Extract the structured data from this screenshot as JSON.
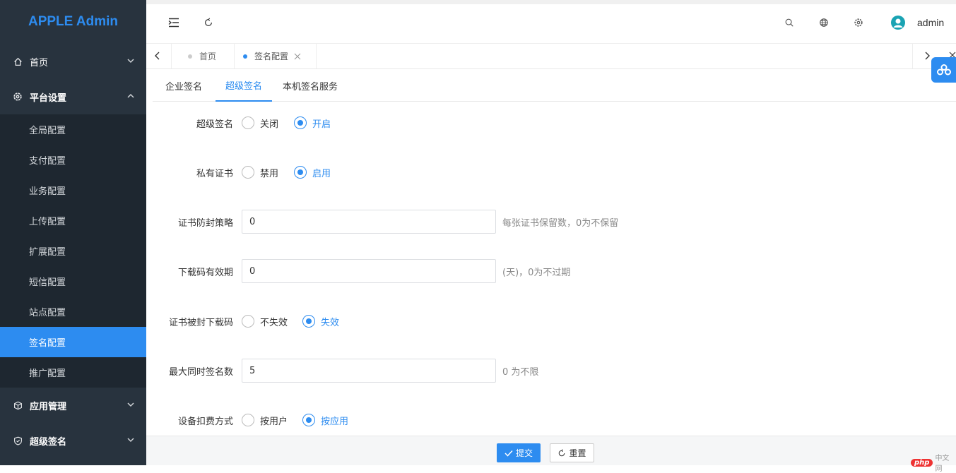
{
  "app": {
    "title": "APPLE Admin"
  },
  "sidebar": {
    "home": "首页",
    "platform": "平台设置",
    "sub_items": [
      "全局配置",
      "支付配置",
      "业务配置",
      "上传配置",
      "扩展配置",
      "短信配置",
      "站点配置",
      "签名配置",
      "推广配置"
    ],
    "active_sub": "签名配置",
    "app_mgmt": "应用管理",
    "super_sign": "超级签名"
  },
  "topbar": {
    "user": "admin"
  },
  "tabs": {
    "home": "首页",
    "current": "签名配置"
  },
  "subtabs": [
    "企业签名",
    "超级签名",
    "本机签名服务"
  ],
  "form": {
    "super_sign": {
      "label": "超级签名",
      "opt_off": "关闭",
      "opt_on": "开启",
      "selected": "开启"
    },
    "private_cert": {
      "label": "私有证书",
      "opt_off": "禁用",
      "opt_on": "启用",
      "selected": "启用"
    },
    "cert_policy": {
      "label": "证书防封策略",
      "value": "0",
      "hint": "每张证书保留数，0为不保留"
    },
    "download_valid": {
      "label": "下载码有效期",
      "value": "0",
      "hint": "(天)，0为不过期"
    },
    "cert_banned": {
      "label": "证书被封下载码",
      "opt_a": "不失效",
      "opt_b": "失效",
      "selected": "失效"
    },
    "max_sign": {
      "label": "最大同时签名数",
      "value": "5",
      "hint": "0 为不限"
    },
    "device_fee": {
      "label": "设备扣费方式",
      "opt_a": "按用户",
      "opt_b": "按应用",
      "selected": "按应用"
    }
  },
  "footer": {
    "submit": "提交",
    "reset": "重置"
  },
  "watermark": {
    "php": "php",
    "text": "中文网"
  },
  "colors": {
    "accent": "#2d8cf0",
    "sidebar_bg": "#28333e",
    "submenu_bg": "#1e2730"
  }
}
